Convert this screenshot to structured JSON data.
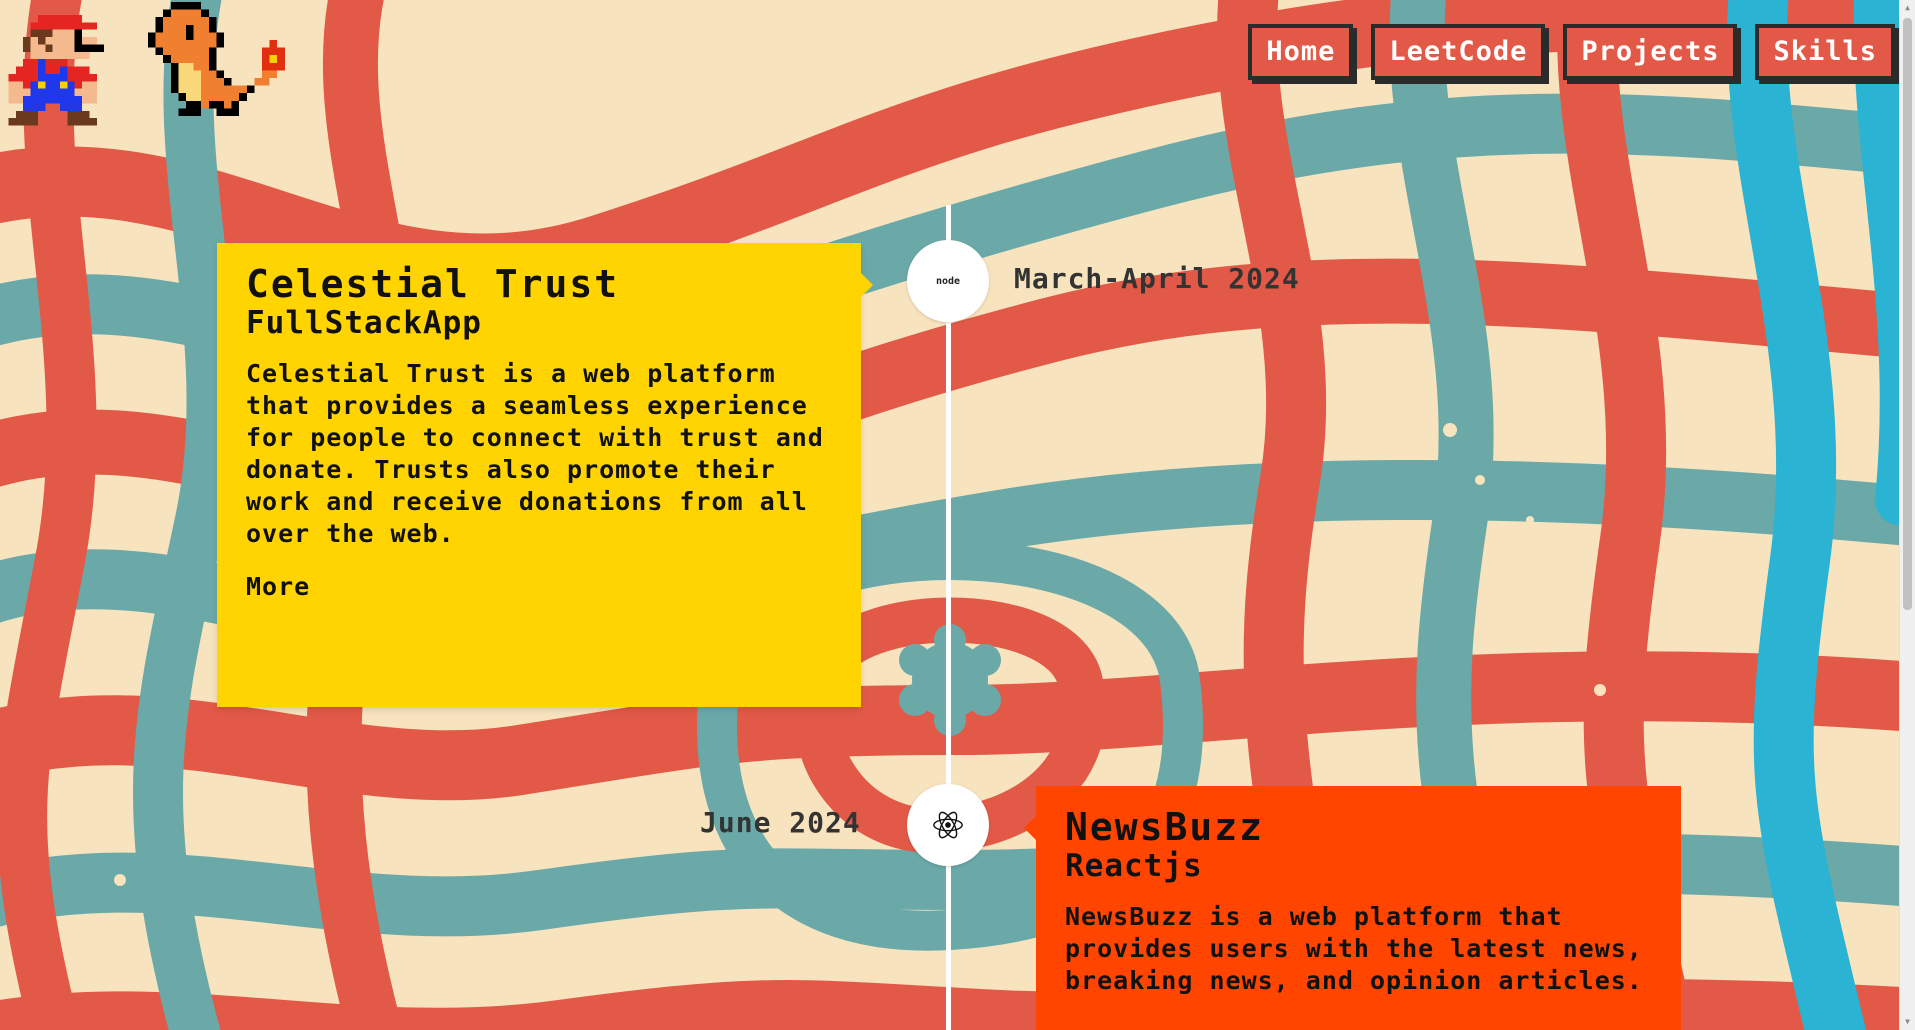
{
  "nav": {
    "items": [
      {
        "label": "Home"
      },
      {
        "label": "LeetCode"
      },
      {
        "label": "Projects"
      },
      {
        "label": "Skills"
      }
    ]
  },
  "timeline": [
    {
      "date": "March-April 2024",
      "icon": "nodejs-logo-icon",
      "icon_text": "node",
      "title": "Celestial Trust",
      "subtitle": "FullStackApp",
      "description": "Celestial Trust is a web platform that provides a seamless experience for people to connect with trust and donate. Trusts also promote their work and receive donations from all over the web.",
      "more": "More",
      "color": "#ffd400"
    },
    {
      "date": "June 2024",
      "icon": "react-logo-icon",
      "title": "NewsBuzz",
      "subtitle": "Reactjs",
      "description": "NewsBuzz is a web platform that provides users with the latest news, breaking news, and opinion articles.",
      "color": "#ff4500"
    }
  ],
  "colors": {
    "cream": "#f8e3bf",
    "red": "#e25a47",
    "teal": "#6aa9a8",
    "blue": "#2ab3d3",
    "yellow_card": "#ffd400",
    "orange_card": "#ff4500"
  }
}
